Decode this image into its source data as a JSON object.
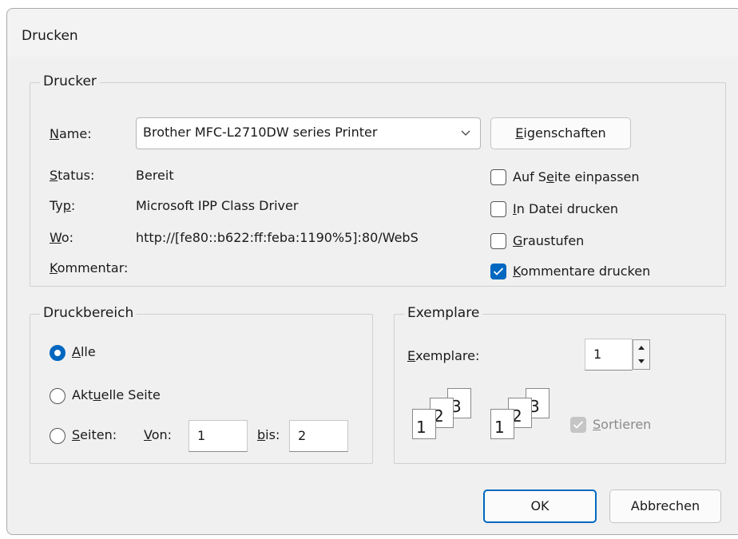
{
  "dialog": {
    "title": "Drucken"
  },
  "printer": {
    "legend": "Drucker",
    "name_label_u": "N",
    "name_label_rest": "ame:",
    "selected": "Brother MFC-L2710DW series Printer",
    "properties_u": "E",
    "properties_rest": "igenschaften",
    "status_label_u": "S",
    "status_label_rest": "tatus:",
    "status_value": "Bereit",
    "type_label_pre": "Ty",
    "type_label_u": "p",
    "type_label_post": ":",
    "type_value": "Microsoft IPP Class Driver",
    "where_label_u": "W",
    "where_label_rest": "o:",
    "where_value": "http://[fe80::b622:ff:feba:1190%5]:80/WebS",
    "comment_label_u": "K",
    "comment_label_rest": "ommentar:",
    "options": [
      {
        "pre": "Auf S",
        "u": "e",
        "post": "ite einpassen",
        "checked": false
      },
      {
        "pre": "",
        "u": "I",
        "post": "n Datei drucken",
        "checked": false
      },
      {
        "pre": "",
        "u": "G",
        "post": "raustufen",
        "checked": false
      },
      {
        "pre": "",
        "u": "K",
        "post": "ommentare drucken",
        "checked": true
      }
    ]
  },
  "range": {
    "legend": "Druckbereich",
    "all_u": "A",
    "all_rest": "lle",
    "current_pre": "Akt",
    "current_u": "u",
    "current_post": "elle Seite",
    "pages_u": "S",
    "pages_rest": "eiten:",
    "from_u": "V",
    "from_rest": "on:",
    "from_value": "1",
    "to_u": "b",
    "to_rest": "is:",
    "to_value": "2"
  },
  "copies": {
    "legend": "Exemplare",
    "label_u": "E",
    "label_rest": "xemplare:",
    "value": "1",
    "collate_u": "S",
    "collate_rest": "ortieren",
    "pages": [
      "1",
      "2",
      "3"
    ]
  },
  "buttons": {
    "ok": "OK",
    "cancel": "Abbrechen"
  },
  "colors": {
    "accent": "#0067c0"
  }
}
